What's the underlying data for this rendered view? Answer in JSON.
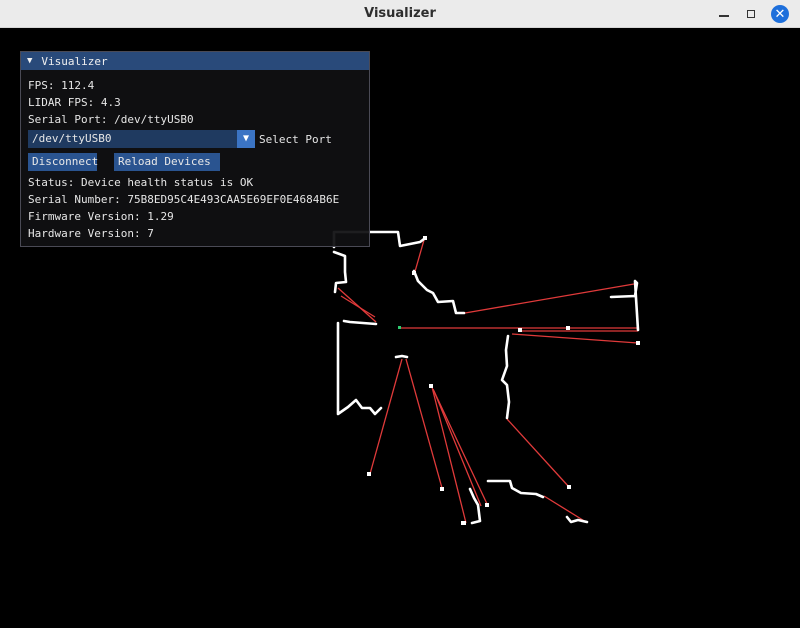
{
  "window": {
    "title": "Visualizer",
    "controls": {
      "minimize": "minimize-icon",
      "maximize": "maximize-icon",
      "close": "close-icon",
      "close_glyph": "✕",
      "close_color": "#1d6fdb"
    }
  },
  "panel": {
    "title": "Visualizer",
    "collapse_glyph": "▼",
    "fps": "FPS: 112.4",
    "lidar_fps": "LIDAR FPS: 4.3",
    "serial_port": "Serial Port: /dev/ttyUSB0",
    "port_combo": {
      "selected": "/dev/ttyUSB0",
      "label": "Select Port",
      "arrow": "▼"
    },
    "buttons": {
      "disconnect": "Disconnect",
      "reload": "Reload Devices"
    },
    "status": "Status: Device health status is OK",
    "serial_number": "Serial Number: 75B8ED95C4E493CAA5E69EF0E4684B6E",
    "firmware": "Firmware Version: 1.29",
    "hardware": "Hardware Version: 7"
  },
  "colors": {
    "background": "#000000",
    "scan_points": "#ffffff",
    "rays": "#e03a3a",
    "sensor": "#2ecc71",
    "panel_header": "#294a7a",
    "button": "#2a5490"
  }
}
